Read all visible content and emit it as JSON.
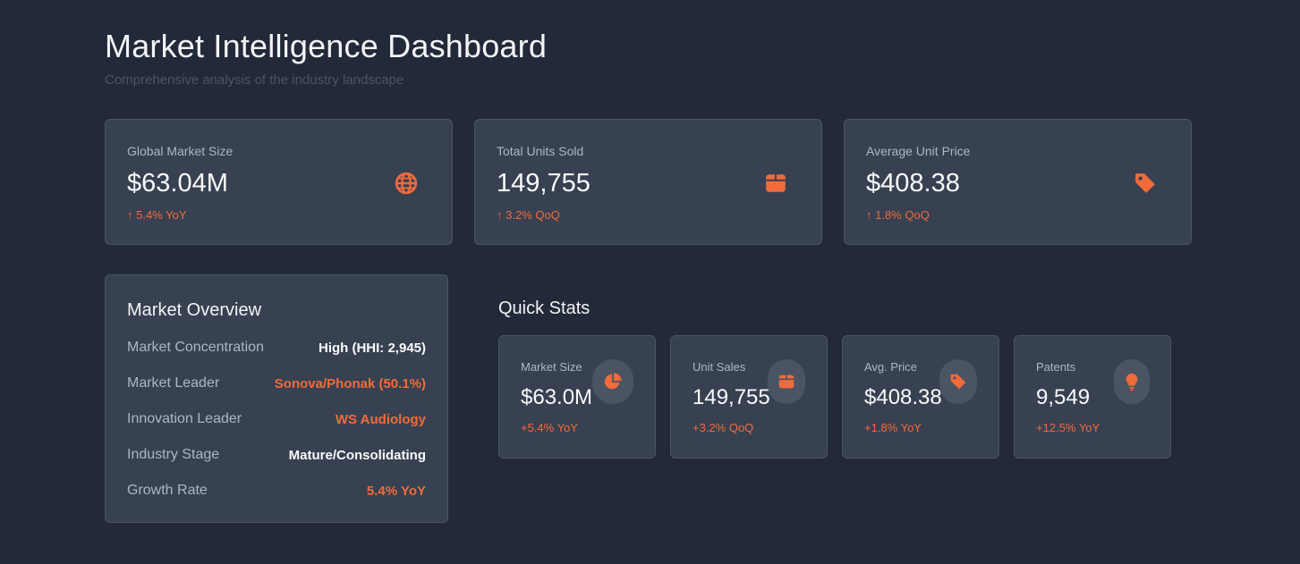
{
  "header": {
    "title": "Market Intelligence Dashboard",
    "subtitle": "Comprehensive analysis of the industry landscape"
  },
  "colors": {
    "background": "#222938",
    "card": "#374151",
    "accent": "#f26b3a"
  },
  "kpis": [
    {
      "label": "Global Market Size",
      "value": "$63.04M",
      "delta": "↑ 5.4% YoY",
      "icon": "globe-icon"
    },
    {
      "label": "Total Units Sold",
      "value": "149,755",
      "delta": "↑ 3.2% QoQ",
      "icon": "box-icon"
    },
    {
      "label": "Average Unit Price",
      "value": "$408.38",
      "delta": "↑ 1.8% QoQ",
      "icon": "tag-icon"
    }
  ],
  "overview": {
    "title": "Market Overview",
    "rows": [
      {
        "key": "Market Concentration",
        "value": "High (HHI: 2,945)",
        "accent": false
      },
      {
        "key": "Market Leader",
        "value": "Sonova/Phonak (50.1%)",
        "accent": true
      },
      {
        "key": "Innovation Leader",
        "value": "WS Audiology",
        "accent": true
      },
      {
        "key": "Industry Stage",
        "value": "Mature/Consolidating",
        "accent": false
      },
      {
        "key": "Growth Rate",
        "value": "5.4% YoY",
        "accent": true
      }
    ]
  },
  "quick_stats": {
    "title": "Quick Stats",
    "items": [
      {
        "label": "Market Size",
        "value": "$63.0M",
        "delta": "+5.4% YoY",
        "icon": "pie-chart-icon"
      },
      {
        "label": "Unit Sales",
        "value": "149,755",
        "delta": "+3.2% QoQ",
        "icon": "box-icon"
      },
      {
        "label": "Avg. Price",
        "value": "$408.38",
        "delta": "+1.8% YoY",
        "icon": "tag-icon"
      },
      {
        "label": "Patents",
        "value": "9,549",
        "delta": "+12.5% YoY",
        "icon": "lightbulb-icon"
      }
    ]
  }
}
